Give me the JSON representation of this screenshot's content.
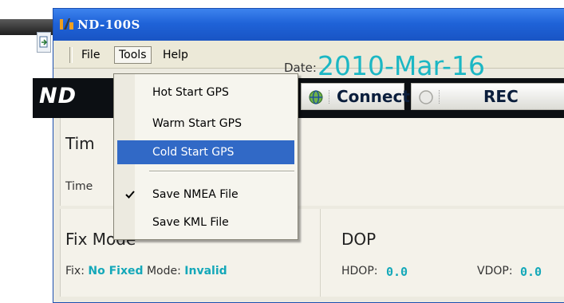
{
  "window": {
    "title": "ND-100S"
  },
  "menubar": {
    "items": [
      "File",
      "Tools",
      "Help"
    ]
  },
  "tools_menu": {
    "items": [
      {
        "label": "Hot Start GPS",
        "checked": false,
        "selected": false
      },
      {
        "label": "Warm Start GPS",
        "checked": false,
        "selected": false
      },
      {
        "label": "Cold Start GPS",
        "checked": false,
        "selected": true
      },
      {
        "label": "Save NMEA File",
        "checked": true,
        "selected": false
      },
      {
        "label": "Save KML File",
        "checked": false,
        "selected": false
      }
    ]
  },
  "header": {
    "logo": "ND"
  },
  "toolbar": {
    "connect_label": "Connect",
    "rec_label": "REC"
  },
  "time_panel": {
    "title": "Tim",
    "time_label": "Time",
    "date_label": "Date:",
    "date_value": "2010-Mar-16"
  },
  "fix_panel": {
    "title": "Fix Mode",
    "fix_label": "Fix:",
    "fix_value": "No Fixed",
    "mode_label": "Mode:",
    "mode_value": "Invalid"
  },
  "dop_panel": {
    "title": "DOP",
    "hdop_label": "HDOP:",
    "hdop_value": "0.0",
    "vdop_label": "VDOP:",
    "vdop_value": "0.0"
  },
  "colors": {
    "titlebar": "#1f63d8",
    "menu_highlight": "#3169c6",
    "value_accent": "#14a8b9",
    "header_band": "#0c0f13"
  },
  "icons": {
    "app": "app-logo-icon",
    "connect": "connect-globe-icon",
    "rec": "record-circle-icon",
    "check": "check-icon"
  }
}
